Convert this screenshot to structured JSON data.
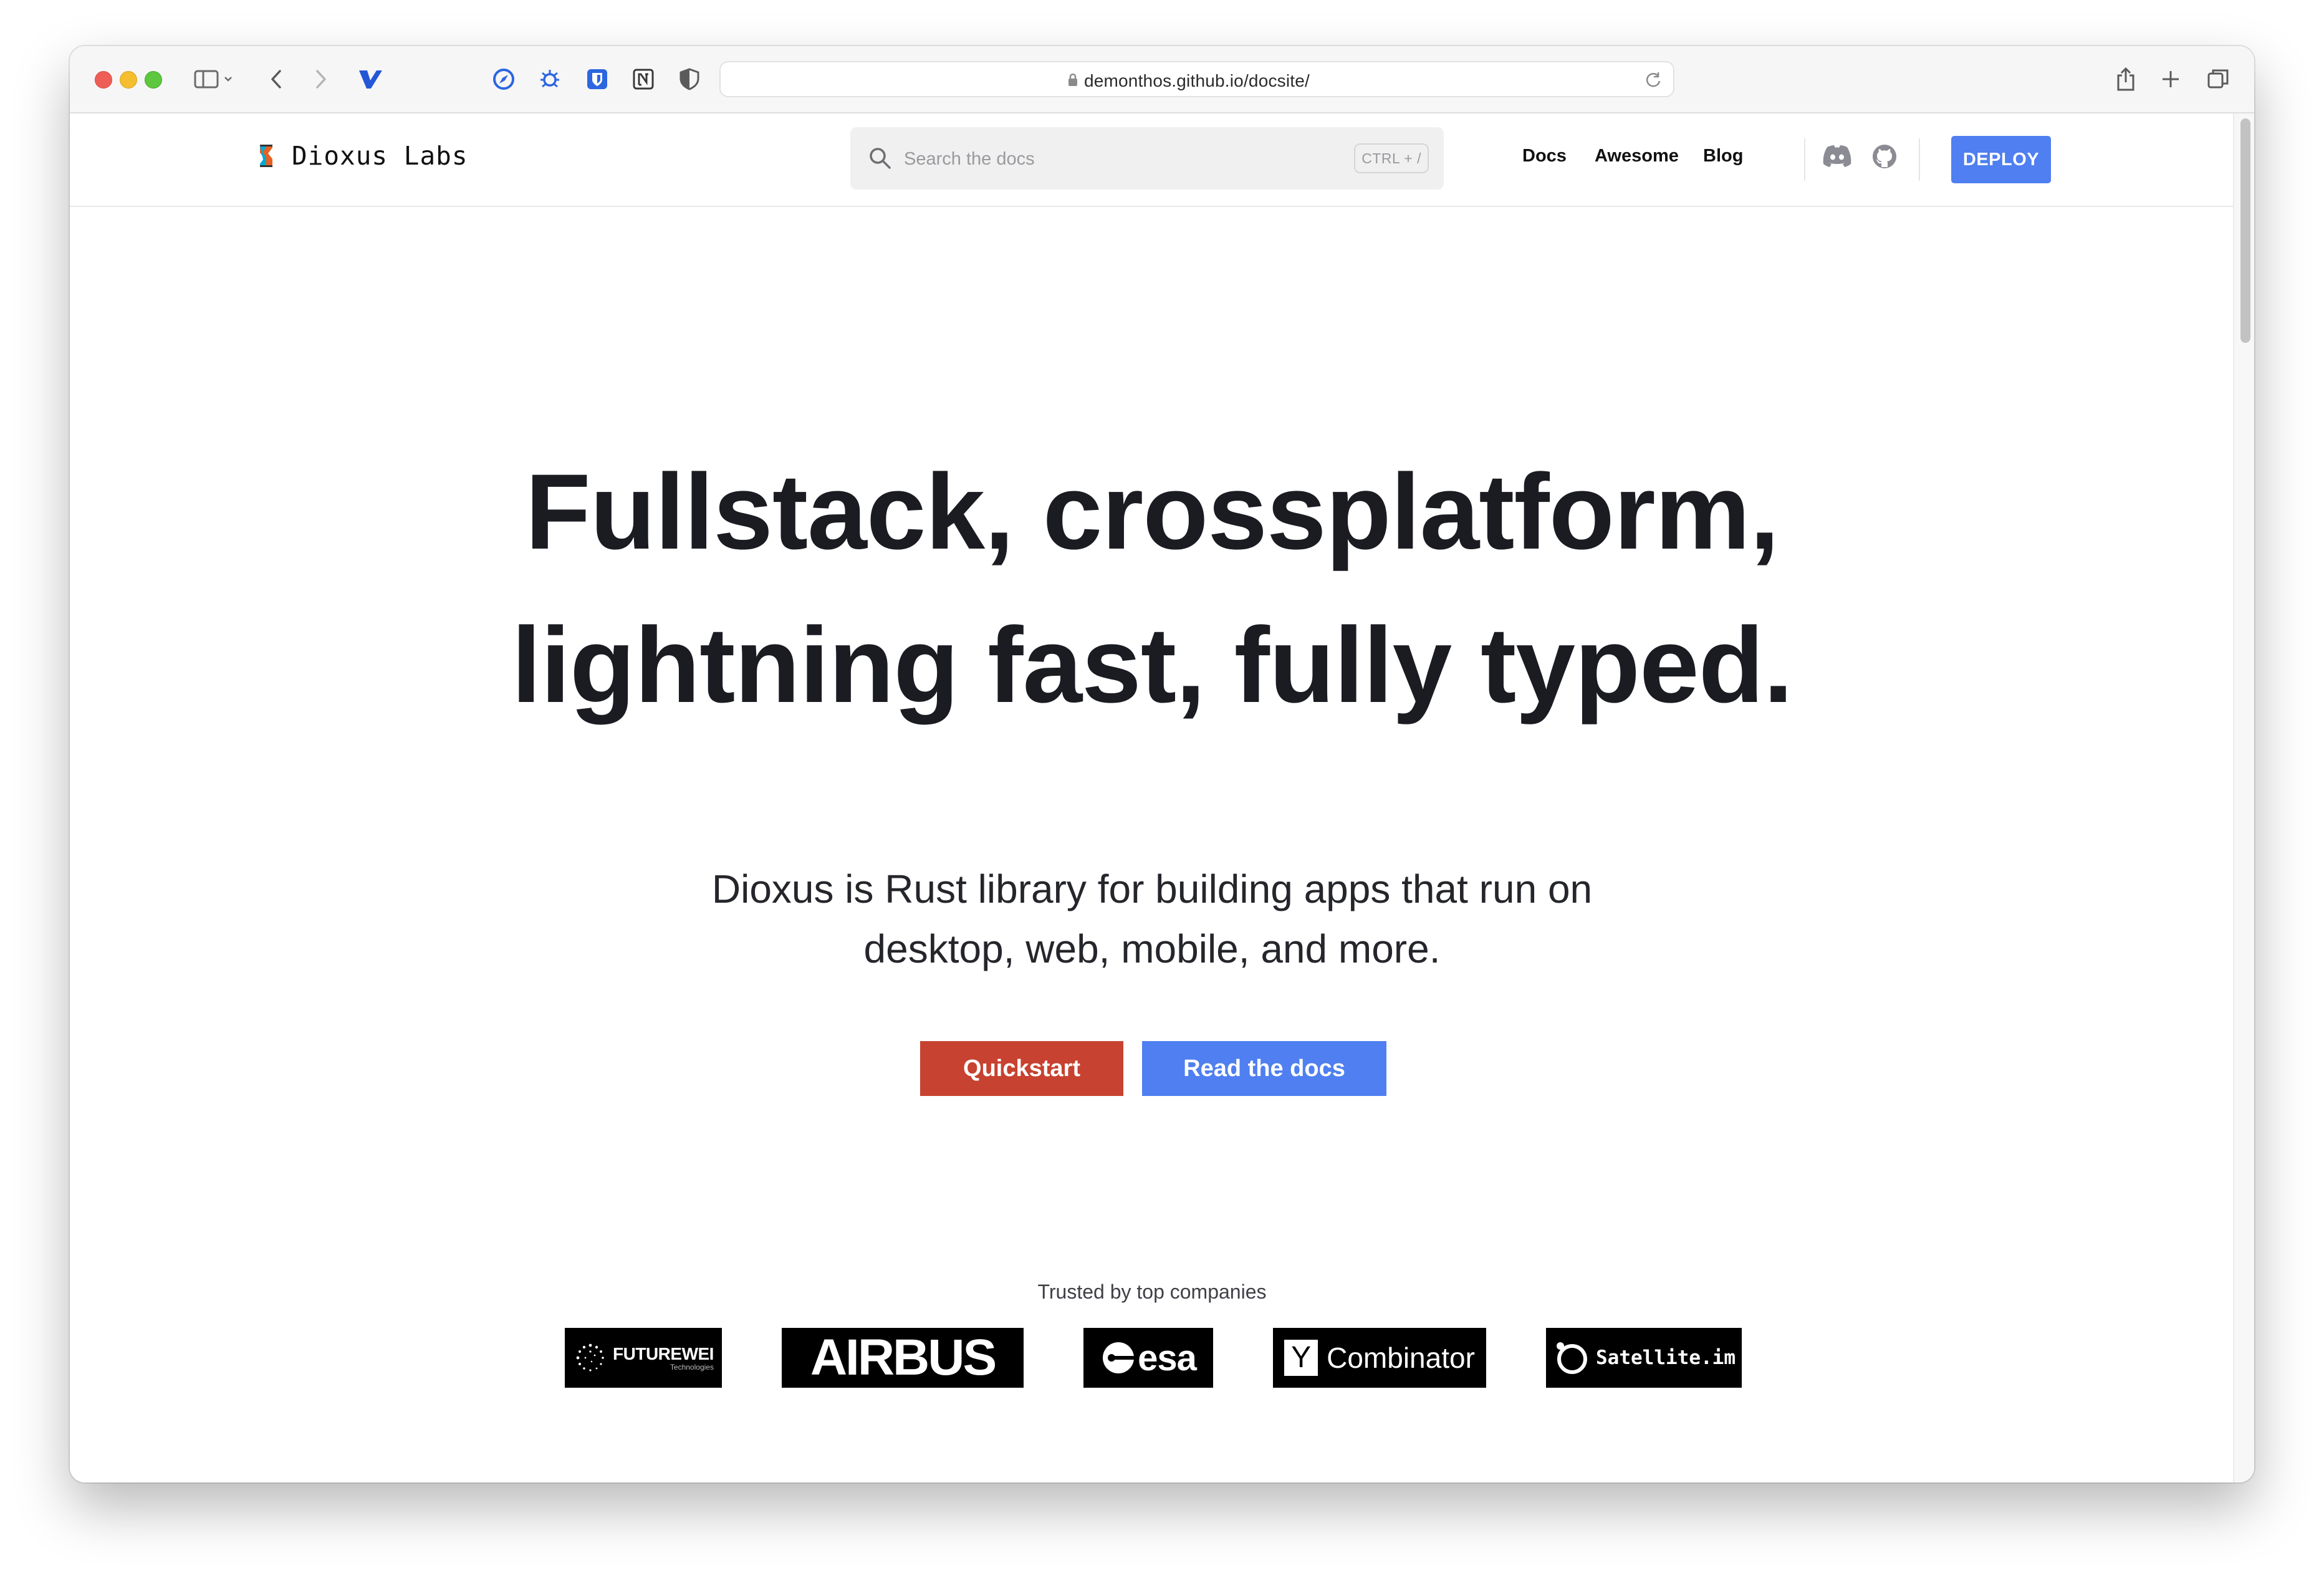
{
  "browser": {
    "url": "demonthos.github.io/docsite/"
  },
  "nav": {
    "brand": "Dioxus Labs",
    "search_placeholder": "Search the docs",
    "search_shortcut": "CTRL + /",
    "links": [
      "Docs",
      "Awesome",
      "Blog"
    ],
    "deploy_label": "DEPLOY"
  },
  "hero": {
    "title_line1": "Fullstack, crossplatform,",
    "title_line2": "lightning fast, fully typed.",
    "subtitle_line1": "Dioxus is Rust library for building apps that run on",
    "subtitle_line2": "desktop, web, mobile, and more.",
    "primary_button": "Quickstart",
    "secondary_button": "Read the docs"
  },
  "trusted": {
    "heading": "Trusted by top companies",
    "logos": {
      "futurewei": "FUTUREWEI",
      "futurewei_sub": "Technologies",
      "airbus": "AIRBUS",
      "esa": "esa",
      "yc_mark": "Y",
      "yc": "Combinator",
      "satellite": "Satellite.im"
    }
  },
  "colors": {
    "deploy_blue": "#4f7ff0",
    "quickstart_red": "#c74230",
    "heading_text": "#1b1c22"
  }
}
